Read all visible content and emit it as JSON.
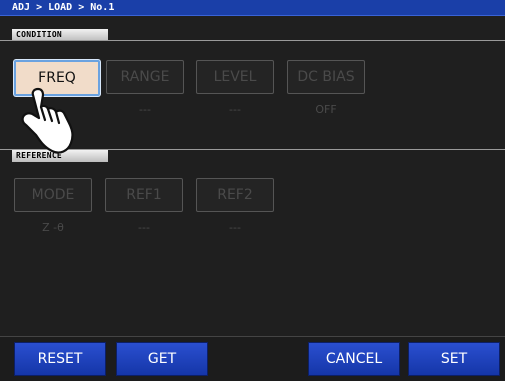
{
  "title_bar": {
    "breadcrumb": "ADJ > LOAD > No.1"
  },
  "condition": {
    "header": "CONDITION",
    "buttons": [
      {
        "label": "FREQ",
        "value": ""
      },
      {
        "label": "RANGE",
        "value": "---"
      },
      {
        "label": "LEVEL",
        "value": "---"
      },
      {
        "label": "DC BIAS",
        "value": "OFF"
      }
    ]
  },
  "reference": {
    "header": "REFERENCE",
    "buttons": [
      {
        "label": "MODE",
        "value": "Z -θ"
      },
      {
        "label": "REF1",
        "value": "---"
      },
      {
        "label": "REF2",
        "value": "---"
      }
    ]
  },
  "footer": {
    "reset": "RESET",
    "get": "GET",
    "cancel": "CANCEL",
    "set": "SET"
  },
  "colors": {
    "title_bar": "#1a3fa8",
    "active_button": "#f1dcc9",
    "footer_button": "#1d42c0"
  },
  "icons": {
    "pointer": "hand-pointer-icon"
  }
}
